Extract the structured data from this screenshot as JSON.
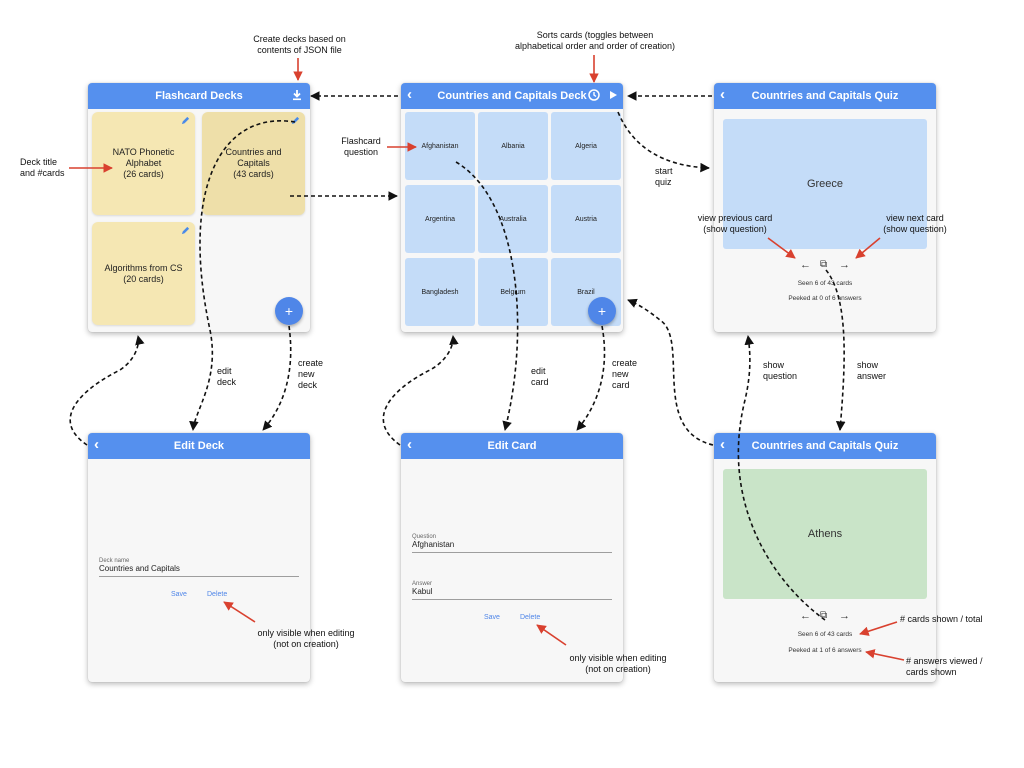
{
  "screens": {
    "decks": {
      "title": "Flashcard Decks",
      "decks": [
        {
          "label": "NATO Phonetic\nAlphabet\n(26 cards)"
        },
        {
          "label": "Countries and\nCapitals\n(43 cards)"
        },
        {
          "label": "Algorithms from CS\n(20 cards)"
        }
      ],
      "fab_label": "+"
    },
    "deck": {
      "title": "Countries and Capitals Deck",
      "cards": [
        "Afghanistan",
        "Albania",
        "Algeria",
        "Argentina",
        "Australia",
        "Austria",
        "Bangladesh",
        "Belgium",
        "Brazil"
      ],
      "fab_label": "+"
    },
    "quiz_question": {
      "title": "Countries and Capitals Quiz",
      "card_text": "Greece",
      "seen": "Seen 6 of 43 cards",
      "peeked": "Peeked at 0 of 6 answers"
    },
    "edit_deck": {
      "title": "Edit Deck",
      "field_label": "Deck name",
      "field_value": "Countries and Capitals",
      "save": "Save",
      "delete": "Delete"
    },
    "edit_card": {
      "title": "Edit Card",
      "question_label": "Question",
      "question_value": "Afghanistan",
      "answer_label": "Answer",
      "answer_value": "Kabul",
      "save": "Save",
      "delete": "Delete"
    },
    "quiz_answer": {
      "title": "Countries and Capitals Quiz",
      "card_text": "Athens",
      "seen": "Seen 6 of 43 cards",
      "peeked": "Peeked at 1 of 6 answers"
    }
  },
  "nav_glyphs": {
    "back": "‹",
    "prev": "←",
    "next": "→",
    "flip": "⧉"
  },
  "annotations": {
    "create_decks": "Create decks based on\ncontents of JSON file",
    "sorts_cards": "Sorts cards (toggles between\nalphabetical order and order of  creation)",
    "deck_title": "Deck title\nand #cards",
    "flashcard_question": "Flashcard\nquestion",
    "start_quiz": "start\nquiz",
    "view_previous": "view previous card\n(show question)",
    "view_next": "view next card\n(show question)",
    "edit_deck": "edit\ndeck",
    "create_deck": "create\nnew\ndeck",
    "edit_card": "edit\ncard",
    "create_card": "create\nnew\ncard",
    "show_question": "show\nquestion",
    "show_answer": "show\nanswer",
    "only_visible_1": "only visible when editing\n(not on creation)",
    "only_visible_2": "only visible when editing\n(not on creation)",
    "cards_shown_total": "# cards shown / total",
    "answers_viewed": "# answers viewed /\ncards shown"
  },
  "colors": {
    "appbar": "#5590ee",
    "deck_card": "#f5e7b3",
    "flashcard": "#c4dcf8",
    "quiz_question_card": "#c4dcf8",
    "quiz_answer_card": "#c9e4c8",
    "link": "#4f86e8",
    "annotation_arrow": "#d9412f"
  }
}
